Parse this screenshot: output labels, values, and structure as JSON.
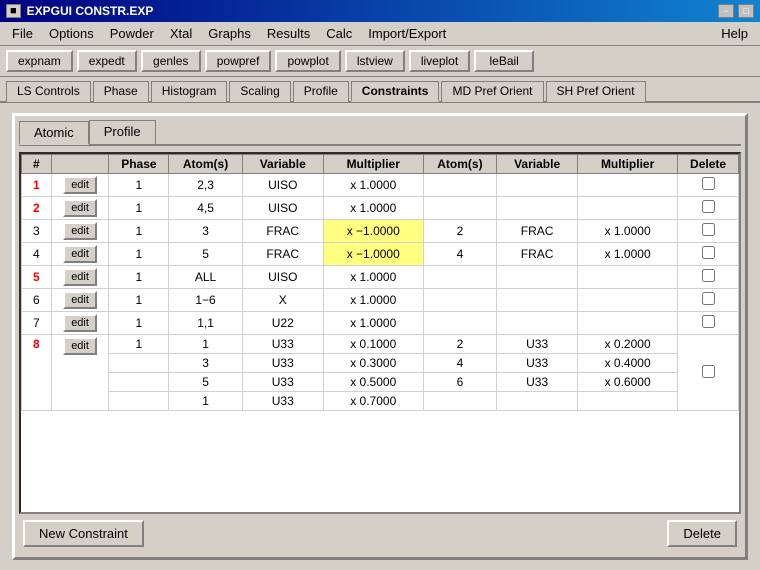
{
  "titleBar": {
    "title": "EXPGUI CONSTR.EXP",
    "minBtn": "−",
    "maxBtn": "□",
    "sysIcon": "■"
  },
  "menuBar": {
    "items": [
      "File",
      "Options",
      "Powder",
      "Xtal",
      "Graphs",
      "Results",
      "Calc",
      "Import/Export",
      "Help"
    ]
  },
  "toolbar": {
    "buttons": [
      "expnam",
      "expedt",
      "genles",
      "powpref",
      "powplot",
      "lstview",
      "liveplot",
      "leBail"
    ]
  },
  "tabs": {
    "items": [
      "LS Controls",
      "Phase",
      "Histogram",
      "Scaling",
      "Profile",
      "Constraints",
      "MD Pref Orient",
      "SH Pref Orient"
    ],
    "active": "Constraints"
  },
  "innerTabs": {
    "items": [
      "Atomic",
      "Profile"
    ],
    "active": "Atomic"
  },
  "table": {
    "headers": [
      "#",
      "",
      "Phase",
      "Atom(s)",
      "Variable",
      "Multiplier",
      "Atom(s)",
      "Variable",
      "Multiplier",
      "Delete"
    ],
    "rows": [
      {
        "num": "1",
        "numColor": "red",
        "hasEdit": true,
        "phase": "1",
        "atoms": "2,3",
        "variable": "UISO",
        "mult": "x 1.0000",
        "atoms2": "",
        "var2": "",
        "mult2": "",
        "delete": false
      },
      {
        "num": "2",
        "numColor": "red",
        "hasEdit": true,
        "phase": "1",
        "atoms": "4,5",
        "variable": "UISO",
        "mult": "x 1.0000",
        "atoms2": "",
        "var2": "",
        "mult2": "",
        "delete": false
      },
      {
        "num": "3",
        "numColor": "black",
        "hasEdit": true,
        "phase": "1",
        "atoms": "3",
        "variable": "FRAC",
        "mult": "x −1.0000",
        "atoms2": "2",
        "var2": "FRAC",
        "mult2": "x 1.0000",
        "delete": false,
        "multHighlight": true,
        "mult2Highlight": false
      },
      {
        "num": "4",
        "numColor": "black",
        "hasEdit": true,
        "phase": "1",
        "atoms": "5",
        "variable": "FRAC",
        "mult": "x −1.0000",
        "atoms2": "4",
        "var2": "FRAC",
        "mult2": "x 1.0000",
        "delete": false,
        "multHighlight": true
      },
      {
        "num": "5",
        "numColor": "red",
        "hasEdit": true,
        "phase": "1",
        "atoms": "ALL",
        "variable": "UISO",
        "mult": "x 1.0000",
        "atoms2": "",
        "var2": "",
        "mult2": "",
        "delete": false
      },
      {
        "num": "6",
        "numColor": "black",
        "hasEdit": true,
        "phase": "1",
        "atoms": "1−6",
        "variable": "X",
        "mult": "x 1.0000",
        "atoms2": "",
        "var2": "",
        "mult2": "",
        "delete": false
      },
      {
        "num": "7",
        "numColor": "black",
        "hasEdit": true,
        "phase": "1",
        "atoms": "1,1",
        "variable": "U22",
        "mult": "x 1.0000",
        "atoms2": "",
        "var2": "",
        "mult2": "",
        "delete": false
      },
      {
        "num": "8",
        "numColor": "red",
        "hasEdit": true,
        "phase": "1",
        "atoms": "1\n3\n5\n1",
        "variable": "U33\nU33\nU33\nU33",
        "mult": "x 0.1000\nx 0.3000\nx 0.5000\nx 0.7000",
        "atoms2": "2\n4\n6",
        "var2": "U33\nU33\nU33",
        "mult2": "x 0.2000\nx 0.4000\nx 0.6000",
        "delete": false,
        "multiRow": true
      }
    ]
  },
  "bottomBar": {
    "newConstraintLabel": "New Constraint",
    "deleteLabel": "Delete"
  }
}
